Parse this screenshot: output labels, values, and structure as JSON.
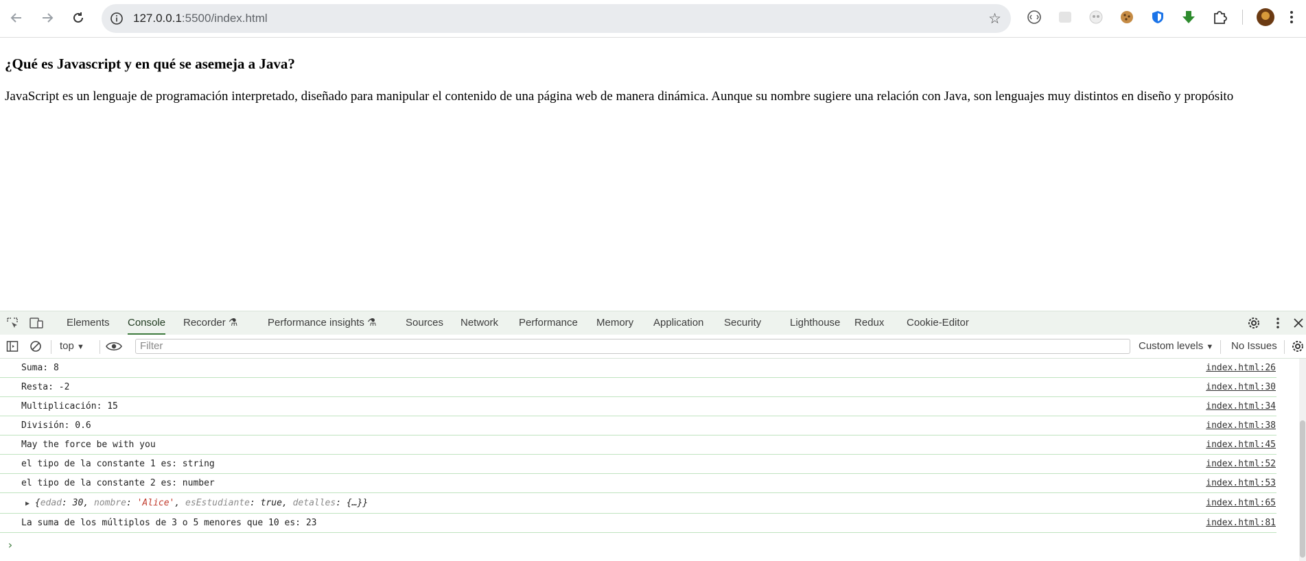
{
  "browser": {
    "url_host": "127.0.0.1",
    "url_rest": ":5500/index.html"
  },
  "page": {
    "heading": "¿Qué es Javascript y en qué se asemeja a Java?",
    "paragraph": "JavaScript es un lenguaje de programación interpretado, diseñado para manipular el contenido de una página web de manera dinámica. Aunque su nombre sugiere una relación con Java, son lenguajes muy distintos en diseño y propósito"
  },
  "devtools": {
    "tabs": [
      "Elements",
      "Console",
      "Recorder",
      "Performance insights",
      "Sources",
      "Network",
      "Performance",
      "Memory",
      "Application",
      "Security",
      "Lighthouse",
      "Redux",
      "Cookie-Editor"
    ],
    "active_tab": "Console",
    "context": "top",
    "filter_placeholder": "Filter",
    "levels": "Custom levels",
    "issues": "No Issues",
    "accent_color": "#3c7a3c"
  },
  "console": {
    "rows": [
      {
        "msg": "Suma: 8",
        "src": "index.html:26"
      },
      {
        "msg": "Resta: -2",
        "src": "index.html:30"
      },
      {
        "msg": "Multiplicación: 15",
        "src": "index.html:34"
      },
      {
        "msg": "División: 0.6",
        "src": "index.html:38"
      },
      {
        "msg": "May the force be with you",
        "src": "index.html:45"
      },
      {
        "msg": "el tipo de la constante 1 es: string",
        "src": "index.html:52"
      },
      {
        "msg": "el tipo de la constante 2 es: number",
        "src": "index.html:53"
      },
      {
        "msg": "",
        "src": "index.html:65"
      },
      {
        "msg": "La suma de los múltiplos de 3 o 5 menores que 10 es: 23",
        "src": "index.html:81"
      }
    ],
    "object": {
      "open": "{",
      "k1": "edad",
      "v1": "30",
      "k2": "nombre",
      "v2": "'Alice'",
      "k3": "esEstudiante",
      "v3": "true",
      "k4": "detalles",
      "v4": "{…}",
      "close": "}"
    }
  }
}
